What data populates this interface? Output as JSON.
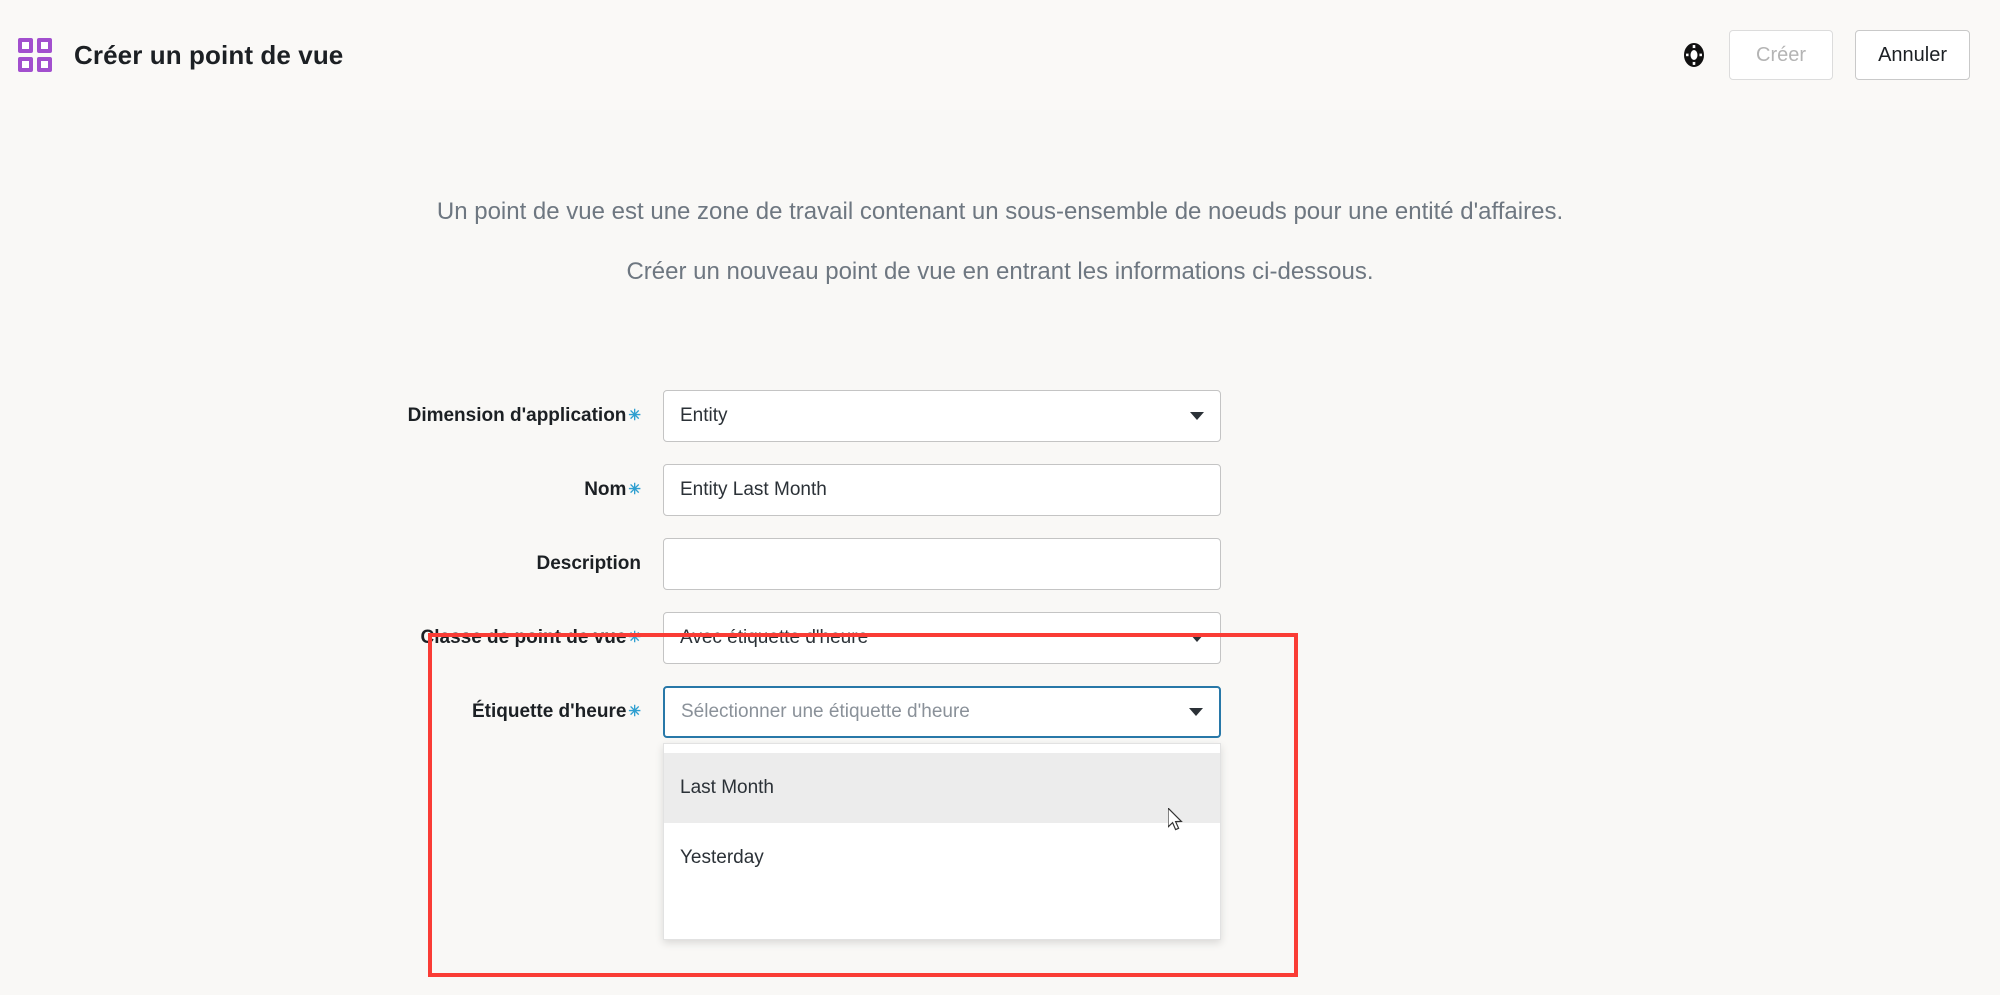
{
  "header": {
    "title": "Créer un point de vue",
    "logo_icon": "grid-squares-icon",
    "help_icon": "help-circle-icon",
    "create_label": "Créer",
    "cancel_label": "Annuler",
    "accent_color": "#a24fce"
  },
  "intro": {
    "line1": "Un point de vue est une zone de travail contenant un sous-ensemble de noeuds pour une entité d'affaires.",
    "line2": "Créer un nouveau point de vue en entrant les informations ci-dessous."
  },
  "form": {
    "required_marker": "✳",
    "fields": {
      "application_dimension": {
        "label": "Dimension d'application",
        "value": "Entity",
        "required": true,
        "type": "select"
      },
      "name": {
        "label": "Nom",
        "value": "Entity Last Month",
        "required": true,
        "type": "text"
      },
      "description": {
        "label": "Description",
        "value": "",
        "required": false,
        "type": "text"
      },
      "viewpoint_class": {
        "label": "Classe de point de vue",
        "value": "Avec étiquette d'heure",
        "required": true,
        "type": "select"
      },
      "time_label": {
        "label": "Étiquette d'heure",
        "value": "",
        "placeholder": "Sélectionner une étiquette d'heure",
        "required": true,
        "type": "select",
        "open": true,
        "options": [
          {
            "label": "",
            "hovered": false
          },
          {
            "label": "Last Month",
            "hovered": true
          },
          {
            "label": "Yesterday",
            "hovered": false
          }
        ]
      }
    }
  },
  "annotation": {
    "highlight_color": "#fa3c35"
  }
}
